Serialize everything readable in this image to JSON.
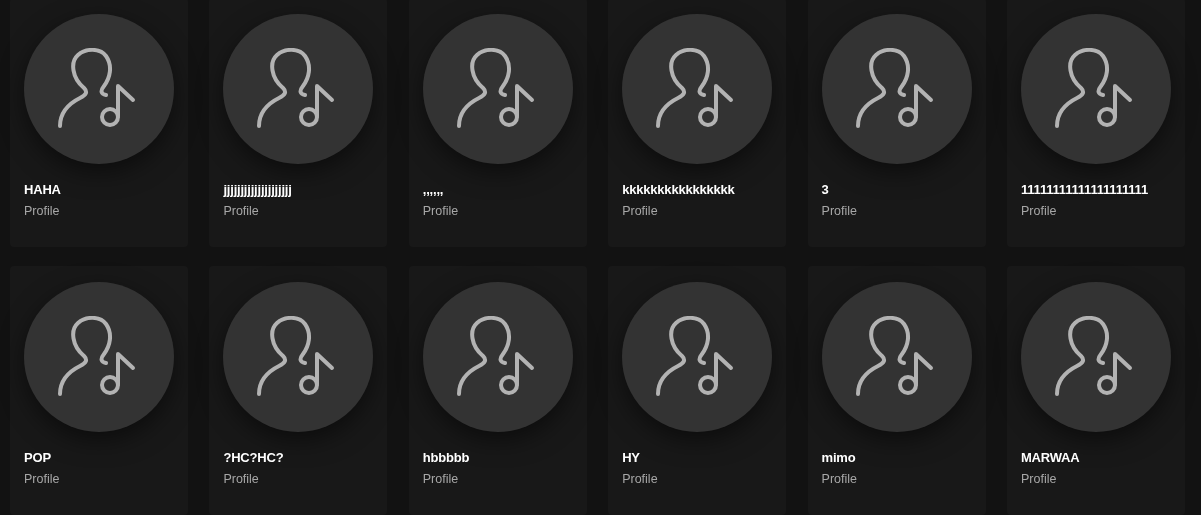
{
  "profiles": [
    {
      "name": "HAHA",
      "type": "Profile"
    },
    {
      "name": "jjjjjjjjjjjjjjjjjjjj",
      "type": "Profile"
    },
    {
      "name": ",,,,,,",
      "type": "Profile"
    },
    {
      "name": "kkkkkkkkkkkkkkkk",
      "type": "Profile"
    },
    {
      "name": "3",
      "type": "Profile"
    },
    {
      "name": "11111111111111111111",
      "type": "Profile"
    },
    {
      "name": "POP",
      "type": "Profile"
    },
    {
      "name": "?HC?HC?",
      "type": "Profile"
    },
    {
      "name": "hbbbbb",
      "type": "Profile"
    },
    {
      "name": "HY",
      "type": "Profile"
    },
    {
      "name": "mimo",
      "type": "Profile"
    },
    {
      "name": "MARWAA",
      "type": "Profile"
    }
  ]
}
